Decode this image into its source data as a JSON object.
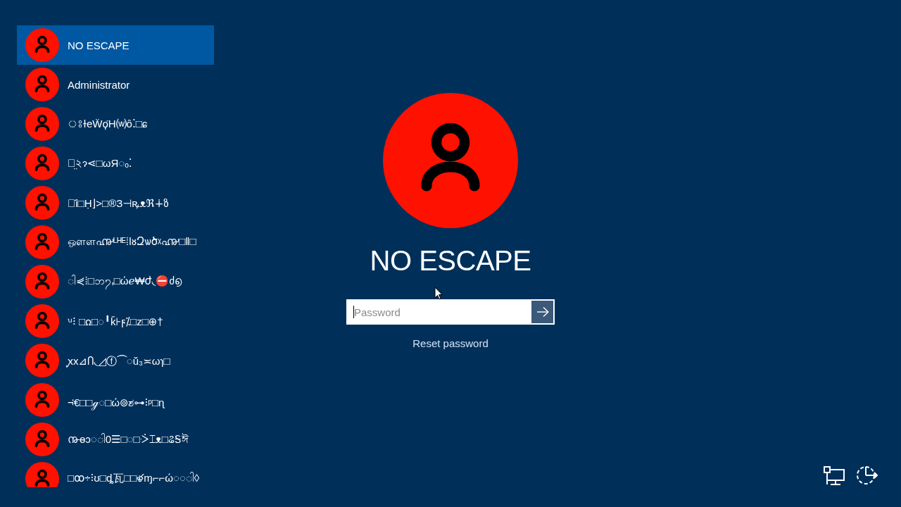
{
  "users": [
    {
      "name": "NO ESCAPE",
      "selected": true
    },
    {
      "name": "Administrator",
      "selected": false
    },
    {
      "name": "ঃɫeẄϙ̈H⒲ȏ⁚□ɕ",
      "selected": false
    },
    {
      "name": "ন̤২ɂ⋖□ωЯ◌ₒ⁚",
      "selected": false
    },
    {
      "name": "ঌ̇ỉ□Ḥ⌋>□®З⊣ꝶᴥℜ∔ზ",
      "selected": false
    },
    {
      "name": "ஔள൷ᴸᴴᴱ⁞ǀᴕԶѡծᵡ൷□ǁ□",
      "selected": false
    },
    {
      "name": "◌ါ⋞⁞□ဘ႒ႇ□ώℯ₩ժ◟⛔ძ൭",
      "selected": false
    },
    {
      "name": "ꭟ⁝ □ꭥ□◌╹ǩ⊦ϝ⁒□z□⊕†",
      "selected": false
    },
    {
      "name": "ꭙx⊿Ⴖ◟◿ⓕ⏜◌ŭ₃≍ωɿ□",
      "selected": false
    },
    {
      "name": "¬ᡃ€□□ℊ◌□ώ⊚ಶ⊶⁝ᵖ□ɳ",
      "selected": false
    },
    {
      "name": "൹ɵɔ◌ါ0☰□◌□ᢶ⌶ᴥ□ଌᎦঈ",
      "selected": false
    },
    {
      "name": "□ꝏ÷⁝ʊ□ȡ瓦□□ళɱ⌐⌐ώ◌◌ါ◊",
      "selected": false
    }
  ],
  "signin": {
    "user_name": "NO ESCAPE",
    "password": {
      "placeholder": "Password"
    },
    "reset_link": "Reset password"
  }
}
